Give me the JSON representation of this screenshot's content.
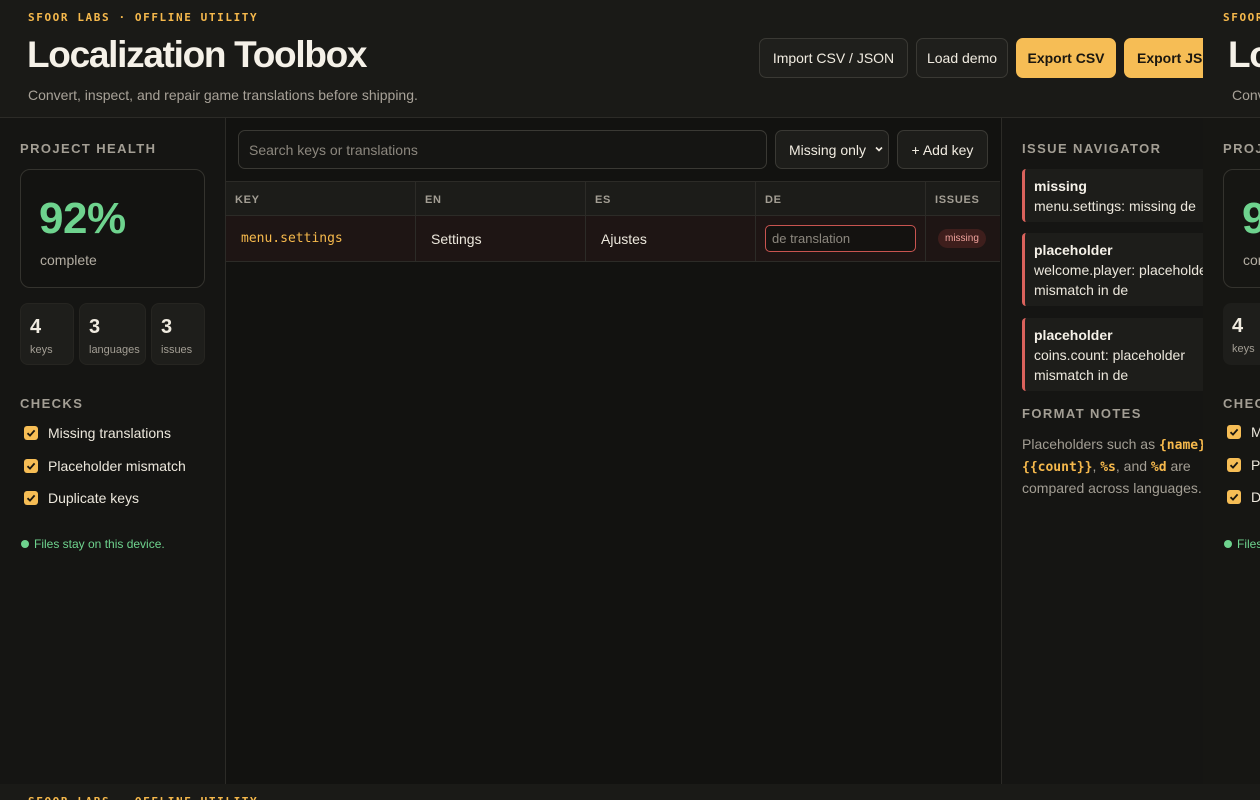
{
  "header": {
    "eyebrow": "SFOOR LABS · OFFLINE UTILITY",
    "title": "Localization Toolbox",
    "subtitle": "Convert, inspect, and repair game translations before shipping.",
    "import_label": "Import CSV / JSON",
    "demo_label": "Load demo",
    "export_csv_label": "Export CSV",
    "export_json_label": "Export JSON"
  },
  "health": {
    "section_label": "PROJECT HEALTH",
    "percent": "92%",
    "percent_value": 92,
    "complete_label": "complete",
    "stats": [
      {
        "value": "4",
        "label": "keys"
      },
      {
        "value": "3",
        "label": "languages"
      },
      {
        "value": "3",
        "label": "issues"
      }
    ]
  },
  "checks": {
    "section_label": "CHECKS",
    "items": [
      {
        "label": "Missing translations",
        "checked": true
      },
      {
        "label": "Placeholder mismatch",
        "checked": true
      },
      {
        "label": "Duplicate keys",
        "checked": true
      }
    ],
    "local_note": "Files stay on this device."
  },
  "toolbar": {
    "search_placeholder": "Search keys or translations",
    "search_value": "",
    "filter_selected": "Missing only",
    "add_key_label": "+ Add key"
  },
  "table": {
    "columns": [
      "KEY",
      "EN",
      "ES",
      "DE",
      "ISSUES"
    ],
    "rows": [
      {
        "key": "menu.settings",
        "en": "Settings",
        "es": "Ajustes",
        "de_value": "",
        "de_placeholder": "de translation",
        "issue": "missing"
      }
    ]
  },
  "navigator": {
    "section_label": "ISSUE NAVIGATOR",
    "issues": [
      {
        "type": "missing",
        "message": "menu.settings: missing de"
      },
      {
        "type": "placeholder",
        "message": "welcome.player: placeholder mismatch in de"
      },
      {
        "type": "placeholder",
        "message": "coins.count: placeholder mismatch in de"
      }
    ]
  },
  "format_notes": {
    "section_label": "FORMAT NOTES",
    "text_prefix": "Placeholders such as ",
    "ph_name": "{name}",
    "ph_count": "{{count}}",
    "ph_s": "%s",
    "sep_1": ", ",
    "sep_2": ", ",
    "text_and": ", and ",
    "ph_d": "%d",
    "text_suffix": " are compared across languages."
  },
  "colors": {
    "accent": "#f6bd55",
    "success": "#6ed38e",
    "danger": "#d9625c",
    "background": "#121210"
  }
}
